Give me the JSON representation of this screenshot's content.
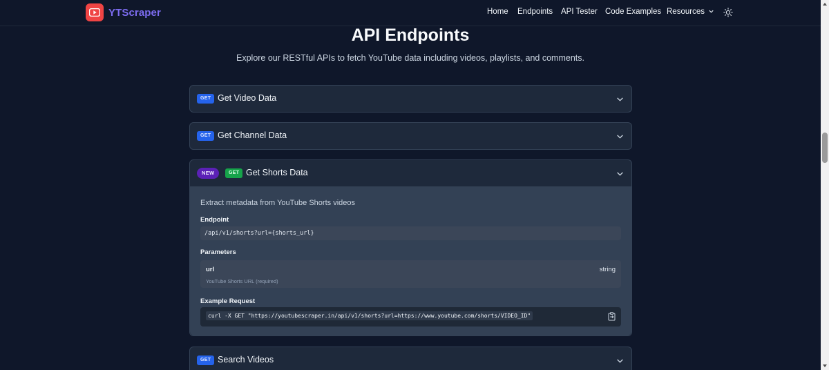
{
  "nav": {
    "brand": "YTScraper",
    "links": [
      "Home",
      "Endpoints",
      "API Tester",
      "Code Examples",
      "Resources"
    ],
    "resources_icon": "chevron-down-icon",
    "theme_icon": "sun-icon"
  },
  "header": {
    "title": "API Endpoints",
    "subtitle": "Explore our RESTful APIs to fetch YouTube data including videos, playlists, and comments."
  },
  "endpoints": [
    {
      "method": "GET",
      "title": "Get Video Data",
      "expanded": false
    },
    {
      "method": "GET",
      "title": "Get Channel Data",
      "expanded": false
    },
    {
      "badge": "NEW",
      "method": "GET",
      "title": "Get Shorts Data",
      "expanded": true,
      "description": "Extract metadata from YouTube Shorts videos",
      "endpoint_label": "Endpoint",
      "endpoint": "/api/v1/shorts?url={shorts_url}",
      "parameters_label": "Parameters",
      "param": {
        "name": "url",
        "type": "string",
        "description": "YouTube Shorts URL (required)"
      },
      "example_label": "Example Request",
      "example": "curl -X GET \"https://youtubescraper.in/api/v1/shorts?url=https://www.youtube.com/shorts/VIDEO_ID\""
    },
    {
      "method": "GET",
      "title": "Search Videos",
      "expanded": false
    }
  ],
  "colors": {
    "background": "#0f172a",
    "panel": "#1e293b",
    "get_badge": "#2563eb",
    "get_badge_active": "#16a34a",
    "new_badge": "#5b21b6",
    "brand": "#7c6cf0",
    "logo": "#ef4444"
  }
}
